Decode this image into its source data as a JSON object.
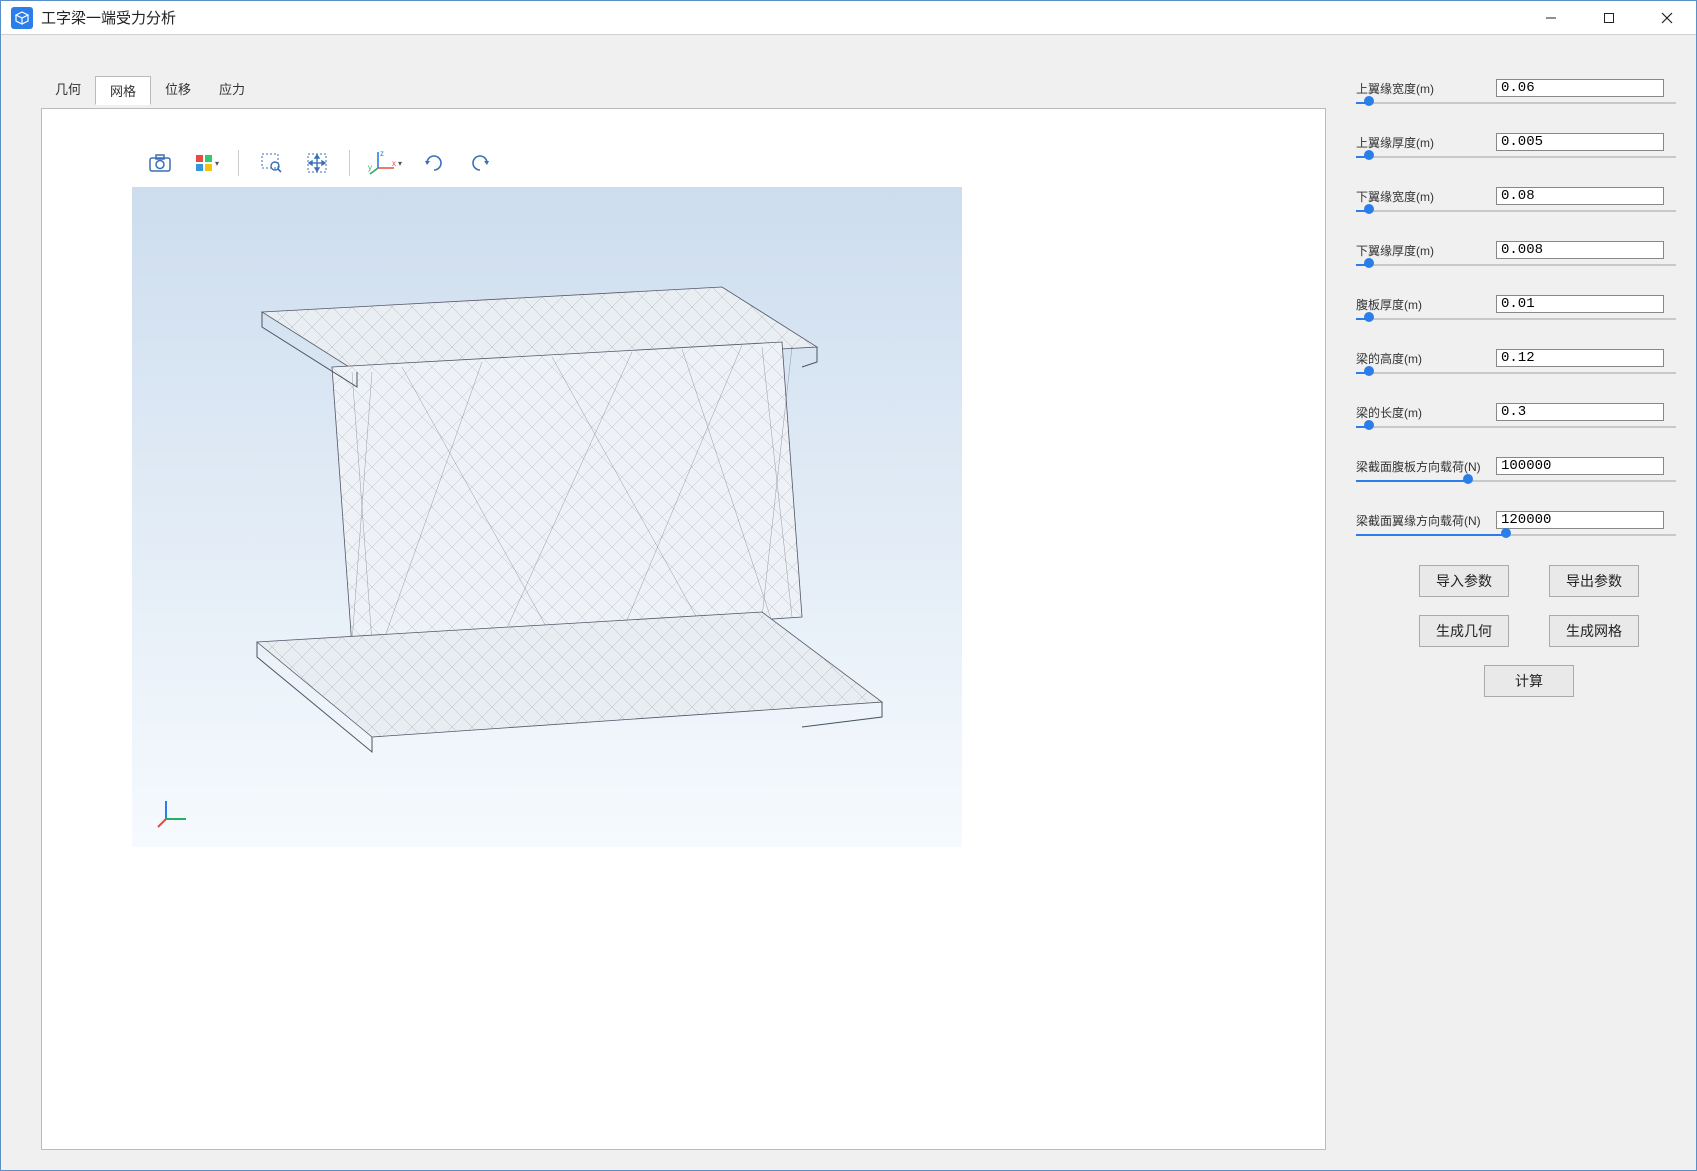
{
  "window": {
    "title": "工字梁一端受力分析"
  },
  "tabs": [
    {
      "id": "geom",
      "label": "几何"
    },
    {
      "id": "mesh",
      "label": "网格"
    },
    {
      "id": "disp",
      "label": "位移"
    },
    {
      "id": "stress",
      "label": "应力"
    }
  ],
  "active_tab": "mesh",
  "params": [
    {
      "id": "top_flange_width",
      "label": "上翼缘宽度(m)",
      "value": "0.06",
      "pct": 4
    },
    {
      "id": "top_flange_thick",
      "label": "上翼缘厚度(m)",
      "value": "0.005",
      "pct": 4
    },
    {
      "id": "bot_flange_width",
      "label": "下翼缘宽度(m)",
      "value": "0.08",
      "pct": 4
    },
    {
      "id": "bot_flange_thick",
      "label": "下翼缘厚度(m)",
      "value": "0.008",
      "pct": 4
    },
    {
      "id": "web_thick",
      "label": "腹板厚度(m)",
      "value": "0.01",
      "pct": 4
    },
    {
      "id": "beam_height",
      "label": "梁的高度(m)",
      "value": "0.12",
      "pct": 4
    },
    {
      "id": "beam_length",
      "label": "梁的长度(m)",
      "value": "0.3",
      "pct": 4
    },
    {
      "id": "load_web_dir",
      "label": "梁截面腹板方向载荷(N)",
      "value": "100000",
      "pct": 35
    },
    {
      "id": "load_flange_dir",
      "label": "梁截面翼缘方向载荷(N)",
      "value": "120000",
      "pct": 47
    }
  ],
  "buttons": {
    "import": "导入参数",
    "export": "导出参数",
    "gen_geom": "生成几何",
    "gen_mesh": "生成网格",
    "compute": "计算"
  },
  "toolbar_icons": [
    "camera-icon",
    "layers-icon",
    "zoom-rect-icon",
    "pan-icon",
    "axis-icon",
    "rotate-cw-icon",
    "rotate-ccw-icon"
  ]
}
